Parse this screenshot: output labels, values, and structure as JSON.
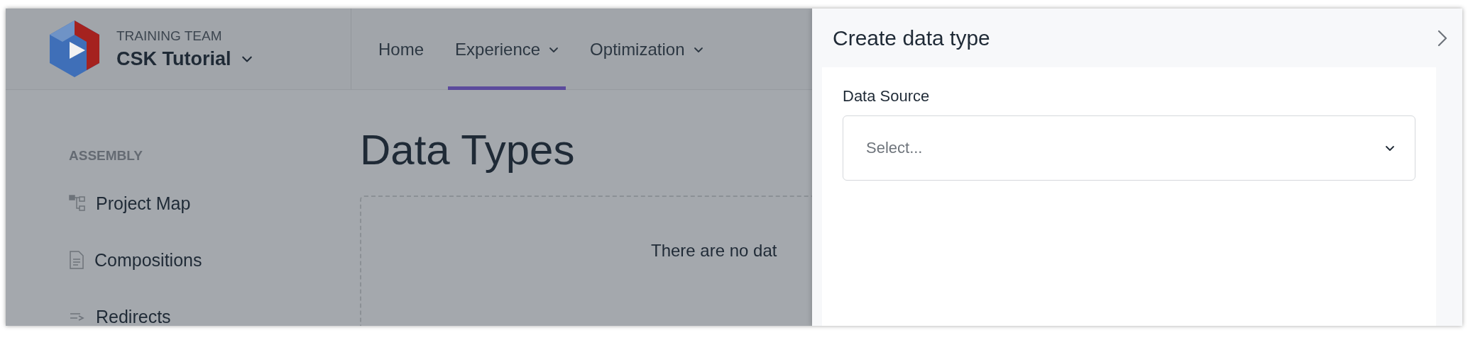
{
  "workspace": {
    "team": "TRAINING TEAM",
    "project": "CSK Tutorial"
  },
  "nav": [
    {
      "label": "Home",
      "selected": false,
      "dropdown": false
    },
    {
      "label": "Experience",
      "selected": true,
      "dropdown": true
    },
    {
      "label": "Optimization",
      "selected": false,
      "dropdown": true
    }
  ],
  "sidebar": {
    "section": "ASSEMBLY",
    "items": [
      {
        "label": "Project Map",
        "kind": "map"
      },
      {
        "label": "Compositions",
        "kind": "doc"
      },
      {
        "label": "Redirects",
        "kind": "redirect"
      }
    ]
  },
  "page": {
    "title": "Data Types",
    "empty_message": "There are no dat"
  },
  "panel": {
    "title": "Create data type",
    "field": {
      "label": "Data Source",
      "placeholder": "Select..."
    }
  }
}
